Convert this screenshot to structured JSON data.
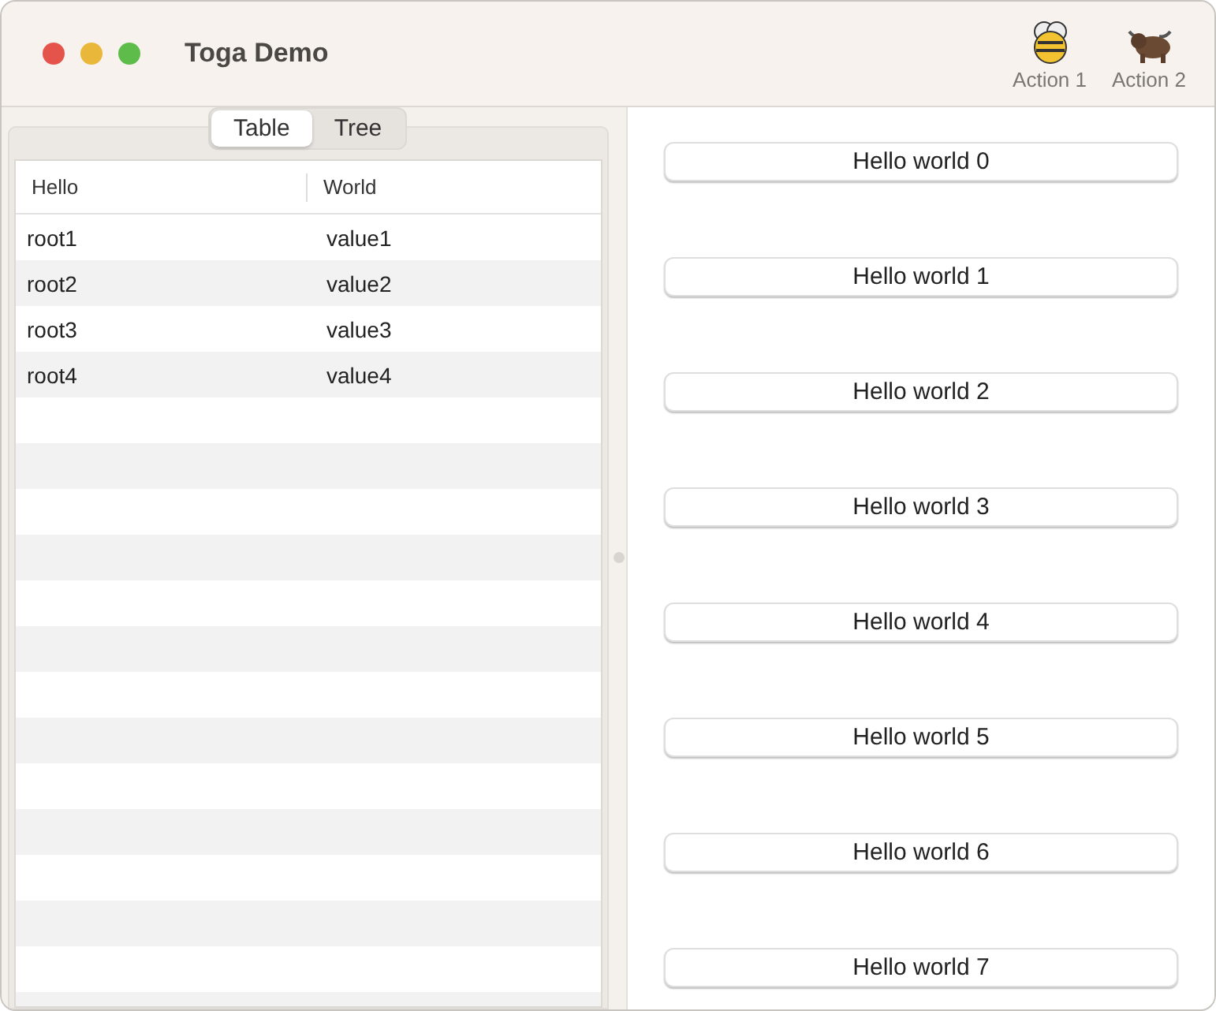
{
  "window": {
    "title": "Toga Demo"
  },
  "toolbar": [
    {
      "label": "Action 1"
    },
    {
      "label": "Action 2"
    }
  ],
  "tabs": [
    {
      "label": "Table",
      "selected": true
    },
    {
      "label": "Tree",
      "selected": false
    }
  ],
  "table": {
    "columns": [
      "Hello",
      "World"
    ],
    "rows": [
      [
        "root1",
        "value1"
      ],
      [
        "root2",
        "value2"
      ],
      [
        "root3",
        "value3"
      ],
      [
        "root4",
        "value4"
      ]
    ]
  },
  "buttons": [
    "Hello world 0",
    "Hello world 1",
    "Hello world 2",
    "Hello world 3",
    "Hello world 4",
    "Hello world 5",
    "Hello world 6",
    "Hello world 7"
  ]
}
